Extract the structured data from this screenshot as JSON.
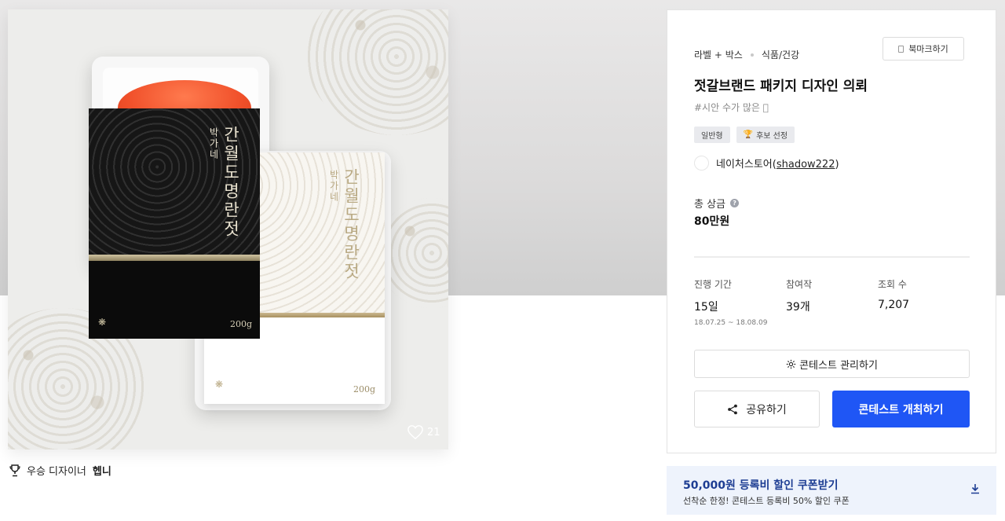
{
  "product_image": {
    "black_box": {
      "title": "간월도명란젓",
      "brand_vertical": "박가네",
      "weight": "200g"
    },
    "white_box": {
      "title": "간월도명란젓",
      "brand_vertical": "박가네",
      "weight": "200g"
    },
    "likes": "21"
  },
  "winner": {
    "label": "우승 디자이너",
    "name": "헵니"
  },
  "contest": {
    "category_main": "라벨 + 박스",
    "category_sub": "식품/건강",
    "bookmark_label": "북마크하기",
    "title": "젓갈브랜드 패키지 디자인 의뢰",
    "hashtag": "#시안 수가 많은 🏻",
    "badges": [
      "일반형",
      "후보 선정"
    ],
    "holder_name": "네이처스토어",
    "holder_id_open": "(",
    "holder_id": "shadow222",
    "holder_id_close": ")",
    "prize_label": "총 상금",
    "prize_value": "80만원",
    "stats": {
      "period_label": "진행 기간",
      "period_value": "15일",
      "period_range": "18.07.25 ~ 18.08.09",
      "entries_label": "참여작",
      "entries_value": "39개",
      "views_label": "조회 수",
      "views_value": "7,207"
    },
    "manage_button": "콘테스트 관리하기",
    "share_button": "공유하기",
    "host_button": "콘테스트 개최하기"
  },
  "coupon": {
    "title": "50,000원 등록비 할인 쿠폰받기",
    "subtitle": "선착순 한정! 콘테스트 등록비 50% 할인 쿠폰"
  },
  "colors": {
    "primary_button": "#1f56f5",
    "coupon_bg": "#eef3fc",
    "coupon_title": "#1d3d93"
  },
  "icons": [
    "heart-icon",
    "trophy-icon",
    "bookmark-icon",
    "help-icon",
    "gear-icon",
    "share-icon",
    "download-icon"
  ]
}
